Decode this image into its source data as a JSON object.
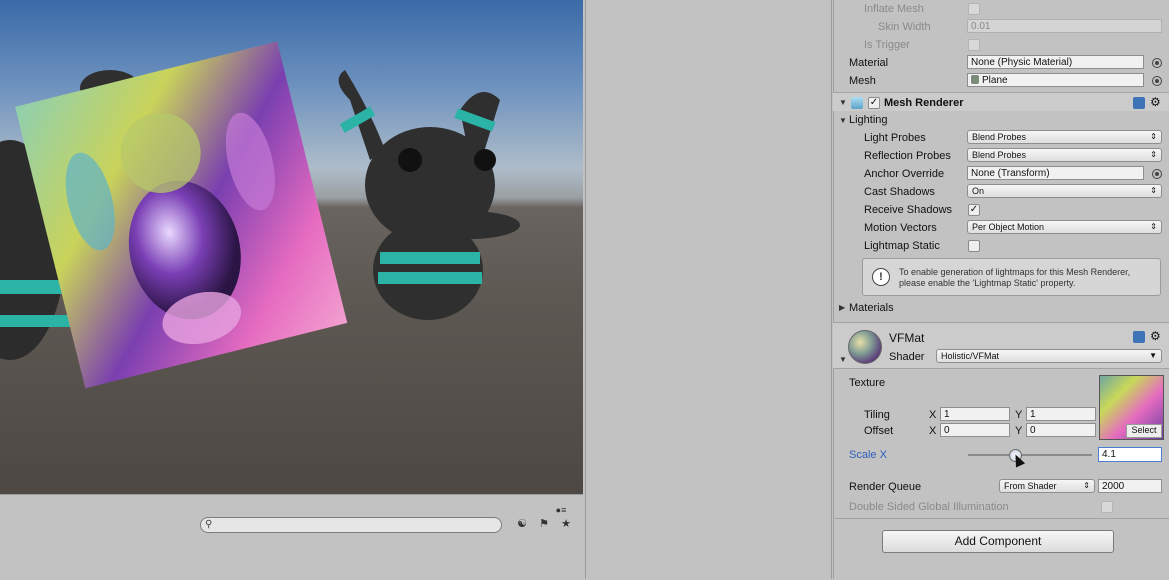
{
  "colors": {
    "inspector_bg": "#c2c2c2",
    "accent_blue": "#2d5fbd",
    "scene_sky": "#3a6aa8",
    "scene_ground": "#5e5853"
  },
  "scene": {
    "search_placeholder": "",
    "icons": [
      "search-icon",
      "layers-icon",
      "tag-icon",
      "star-icon",
      "lock-icon"
    ]
  },
  "collider": {
    "inflate_mesh_label": "Inflate Mesh",
    "skin_width_label": "Skin Width",
    "skin_width_value": "0.01",
    "is_trigger_label": "Is Trigger",
    "material_label": "Material",
    "material_value": "None (Physic Material)",
    "mesh_label": "Mesh",
    "mesh_value": "Plane"
  },
  "mesh_renderer": {
    "title": "Mesh Renderer",
    "lighting_label": "Lighting",
    "light_probes_label": "Light Probes",
    "light_probes_value": "Blend Probes",
    "reflection_probes_label": "Reflection Probes",
    "reflection_probes_value": "Blend Probes",
    "anchor_override_label": "Anchor Override",
    "anchor_override_value": "None (Transform)",
    "cast_shadows_label": "Cast Shadows",
    "cast_shadows_value": "On",
    "receive_shadows_label": "Receive Shadows",
    "receive_shadows_checked": true,
    "motion_vectors_label": "Motion Vectors",
    "motion_vectors_value": "Per Object Motion",
    "lightmap_static_label": "Lightmap Static",
    "help_text": "To enable generation of lightmaps for this Mesh Renderer, please enable the 'Lightmap Static' property.",
    "materials_label": "Materials"
  },
  "material": {
    "name": "VFMat",
    "shader_label": "Shader",
    "shader_value": "Holistic/VFMat",
    "texture_label": "Texture",
    "tiling_label": "Tiling",
    "tiling_x": "1",
    "tiling_y": "1",
    "offset_label": "Offset",
    "offset_x": "0",
    "offset_y": "0",
    "x_label": "X",
    "y_label": "Y",
    "select_label": "Select",
    "scale_x_label": "Scale X",
    "scale_x_value": "4.1",
    "scale_x_slider_fraction": 0.38,
    "render_queue_label": "Render Queue",
    "render_queue_mode": "From Shader",
    "render_queue_value": "2000",
    "double_sided_label": "Double Sided Global Illumination"
  },
  "add_component_label": "Add Component"
}
